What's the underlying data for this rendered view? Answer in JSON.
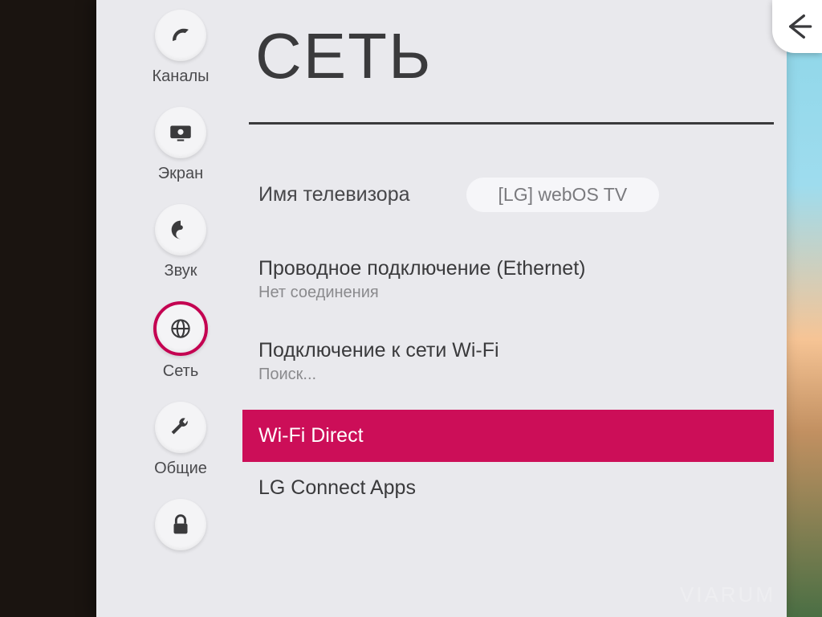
{
  "sidebar": {
    "items": [
      {
        "label": "Каналы",
        "icon": "satellite"
      },
      {
        "label": "Экран",
        "icon": "screen"
      },
      {
        "label": "Звук",
        "icon": "sound"
      },
      {
        "label": "Сеть",
        "icon": "globe",
        "active": true
      },
      {
        "label": "Общие",
        "icon": "wrench"
      },
      {
        "label": "",
        "icon": "lock"
      }
    ]
  },
  "page": {
    "title": "СЕТЬ"
  },
  "settings": {
    "tvname": {
      "label": "Имя телевизора",
      "value": "[LG] webOS TV"
    },
    "wired": {
      "title": "Проводное подключение (Ethernet)",
      "status": "Нет соединения"
    },
    "wifi": {
      "title": "Подключение к сети Wi-Fi",
      "status": "Поиск..."
    },
    "wifidirect": {
      "title": "Wi-Fi Direct"
    },
    "lgconnect": {
      "title": "LG Connect Apps"
    }
  },
  "watermark": "VIARUM"
}
